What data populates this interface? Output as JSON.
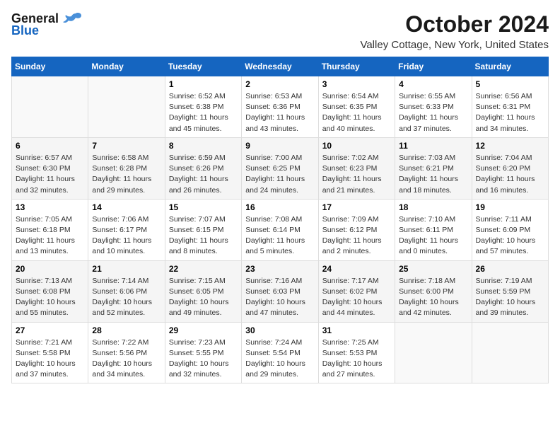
{
  "header": {
    "logo_line1": "General",
    "logo_line2": "Blue",
    "month": "October 2024",
    "location": "Valley Cottage, New York, United States"
  },
  "weekdays": [
    "Sunday",
    "Monday",
    "Tuesday",
    "Wednesday",
    "Thursday",
    "Friday",
    "Saturday"
  ],
  "weeks": [
    [
      {
        "day": "",
        "info": ""
      },
      {
        "day": "",
        "info": ""
      },
      {
        "day": "1",
        "sunrise": "6:52 AM",
        "sunset": "6:38 PM",
        "daylight": "11 hours and 45 minutes."
      },
      {
        "day": "2",
        "sunrise": "6:53 AM",
        "sunset": "6:36 PM",
        "daylight": "11 hours and 43 minutes."
      },
      {
        "day": "3",
        "sunrise": "6:54 AM",
        "sunset": "6:35 PM",
        "daylight": "11 hours and 40 minutes."
      },
      {
        "day": "4",
        "sunrise": "6:55 AM",
        "sunset": "6:33 PM",
        "daylight": "11 hours and 37 minutes."
      },
      {
        "day": "5",
        "sunrise": "6:56 AM",
        "sunset": "6:31 PM",
        "daylight": "11 hours and 34 minutes."
      }
    ],
    [
      {
        "day": "6",
        "sunrise": "6:57 AM",
        "sunset": "6:30 PM",
        "daylight": "11 hours and 32 minutes."
      },
      {
        "day": "7",
        "sunrise": "6:58 AM",
        "sunset": "6:28 PM",
        "daylight": "11 hours and 29 minutes."
      },
      {
        "day": "8",
        "sunrise": "6:59 AM",
        "sunset": "6:26 PM",
        "daylight": "11 hours and 26 minutes."
      },
      {
        "day": "9",
        "sunrise": "7:00 AM",
        "sunset": "6:25 PM",
        "daylight": "11 hours and 24 minutes."
      },
      {
        "day": "10",
        "sunrise": "7:02 AM",
        "sunset": "6:23 PM",
        "daylight": "11 hours and 21 minutes."
      },
      {
        "day": "11",
        "sunrise": "7:03 AM",
        "sunset": "6:21 PM",
        "daylight": "11 hours and 18 minutes."
      },
      {
        "day": "12",
        "sunrise": "7:04 AM",
        "sunset": "6:20 PM",
        "daylight": "11 hours and 16 minutes."
      }
    ],
    [
      {
        "day": "13",
        "sunrise": "7:05 AM",
        "sunset": "6:18 PM",
        "daylight": "11 hours and 13 minutes."
      },
      {
        "day": "14",
        "sunrise": "7:06 AM",
        "sunset": "6:17 PM",
        "daylight": "11 hours and 10 minutes."
      },
      {
        "day": "15",
        "sunrise": "7:07 AM",
        "sunset": "6:15 PM",
        "daylight": "11 hours and 8 minutes."
      },
      {
        "day": "16",
        "sunrise": "7:08 AM",
        "sunset": "6:14 PM",
        "daylight": "11 hours and 5 minutes."
      },
      {
        "day": "17",
        "sunrise": "7:09 AM",
        "sunset": "6:12 PM",
        "daylight": "11 hours and 2 minutes."
      },
      {
        "day": "18",
        "sunrise": "7:10 AM",
        "sunset": "6:11 PM",
        "daylight": "11 hours and 0 minutes."
      },
      {
        "day": "19",
        "sunrise": "7:11 AM",
        "sunset": "6:09 PM",
        "daylight": "10 hours and 57 minutes."
      }
    ],
    [
      {
        "day": "20",
        "sunrise": "7:13 AM",
        "sunset": "6:08 PM",
        "daylight": "10 hours and 55 minutes."
      },
      {
        "day": "21",
        "sunrise": "7:14 AM",
        "sunset": "6:06 PM",
        "daylight": "10 hours and 52 minutes."
      },
      {
        "day": "22",
        "sunrise": "7:15 AM",
        "sunset": "6:05 PM",
        "daylight": "10 hours and 49 minutes."
      },
      {
        "day": "23",
        "sunrise": "7:16 AM",
        "sunset": "6:03 PM",
        "daylight": "10 hours and 47 minutes."
      },
      {
        "day": "24",
        "sunrise": "7:17 AM",
        "sunset": "6:02 PM",
        "daylight": "10 hours and 44 minutes."
      },
      {
        "day": "25",
        "sunrise": "7:18 AM",
        "sunset": "6:00 PM",
        "daylight": "10 hours and 42 minutes."
      },
      {
        "day": "26",
        "sunrise": "7:19 AM",
        "sunset": "5:59 PM",
        "daylight": "10 hours and 39 minutes."
      }
    ],
    [
      {
        "day": "27",
        "sunrise": "7:21 AM",
        "sunset": "5:58 PM",
        "daylight": "10 hours and 37 minutes."
      },
      {
        "day": "28",
        "sunrise": "7:22 AM",
        "sunset": "5:56 PM",
        "daylight": "10 hours and 34 minutes."
      },
      {
        "day": "29",
        "sunrise": "7:23 AM",
        "sunset": "5:55 PM",
        "daylight": "10 hours and 32 minutes."
      },
      {
        "day": "30",
        "sunrise": "7:24 AM",
        "sunset": "5:54 PM",
        "daylight": "10 hours and 29 minutes."
      },
      {
        "day": "31",
        "sunrise": "7:25 AM",
        "sunset": "5:53 PM",
        "daylight": "10 hours and 27 minutes."
      },
      {
        "day": "",
        "info": ""
      },
      {
        "day": "",
        "info": ""
      }
    ]
  ]
}
